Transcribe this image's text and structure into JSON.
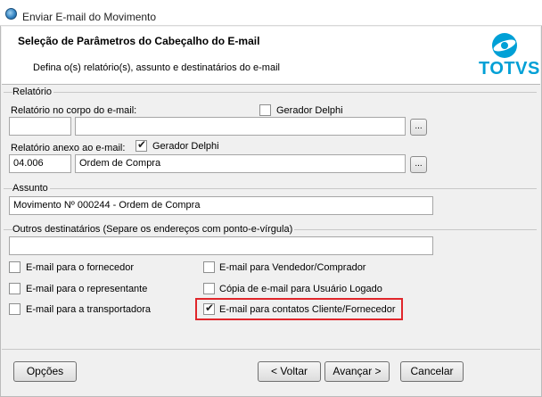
{
  "window": {
    "title": "Enviar E-mail do Movimento"
  },
  "header": {
    "title": "Seleção de Parâmetros do Cabeçalho do E-mail",
    "subtitle": "Defina o(s) relatório(s), assunto e destinatários do e-mail",
    "logo_text": "TOTVS"
  },
  "relatorio": {
    "group_label": "Relatório",
    "corpo_label": "Relatório no corpo do e-mail:",
    "corpo_code": "",
    "corpo_name": "",
    "corpo_gerador_label": "Gerador Delphi",
    "corpo_gerador_checked": false,
    "anexo_label": "Relatório anexo ao e-mail:",
    "anexo_gerador_label": "Gerador Delphi",
    "anexo_gerador_checked": true,
    "anexo_code": "04.006",
    "anexo_name": "Ordem de Compra",
    "browse_label": "..."
  },
  "assunto": {
    "group_label": "Assunto",
    "value": "Movimento Nº 000244 - Ordem de Compra"
  },
  "destinatarios": {
    "group_label": "Outros destinatários (Separe os endereços com ponto-e-vírgula)",
    "value": "",
    "options": [
      {
        "label": "E-mail para o fornecedor",
        "checked": false
      },
      {
        "label": "E-mail para o representante",
        "checked": false
      },
      {
        "label": "E-mail para a transportadora",
        "checked": false
      },
      {
        "label": "E-mail para Vendedor/Comprador",
        "checked": false
      },
      {
        "label": "Cópia de e-mail para Usuário Logado",
        "checked": false
      },
      {
        "label": "E-mail para contatos Cliente/Fornecedor",
        "checked": true
      }
    ]
  },
  "buttons": {
    "options": "Opções",
    "back": "< Voltar",
    "next": "Avançar >",
    "cancel": "Cancelar"
  },
  "colors": {
    "brand": "#00a0d6",
    "highlight": "#e0262b"
  }
}
